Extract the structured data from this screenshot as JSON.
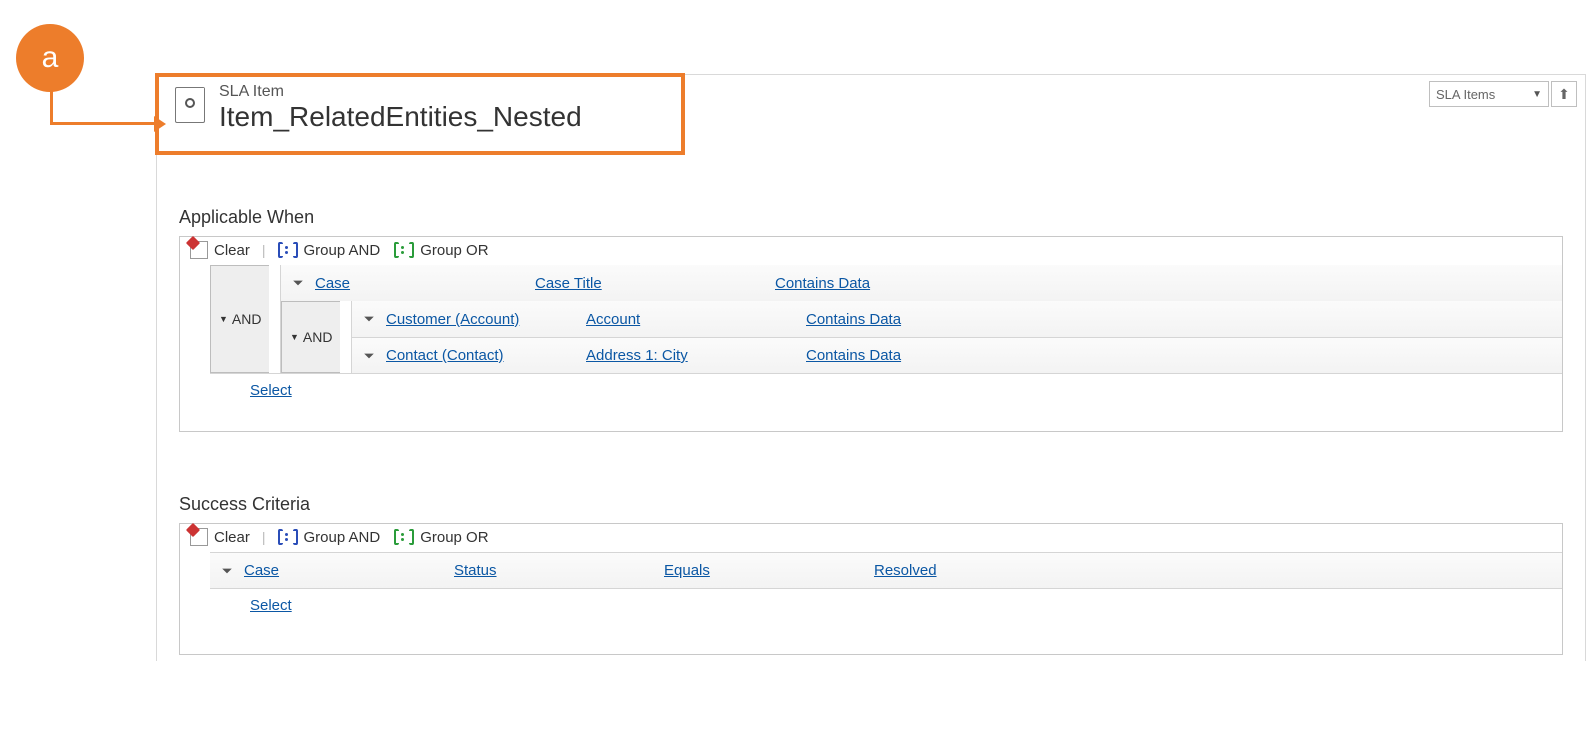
{
  "callout": {
    "badge": "a"
  },
  "header": {
    "entity_type": "SLA Item",
    "entity_name": "Item_RelatedEntities_Nested",
    "nav_section": "SLA Items"
  },
  "toolbar": {
    "clear": "Clear",
    "group_and": "Group AND",
    "group_or": "Group OR"
  },
  "applicable_when": {
    "title": "Applicable When",
    "and_label": "AND",
    "row1": {
      "entity": "Case",
      "field": "Case Title",
      "operator": "Contains Data"
    },
    "nested_and_label": "AND",
    "nested": [
      {
        "entity": "Customer (Account)",
        "field": "Account",
        "operator": "Contains Data"
      },
      {
        "entity": "Contact (Contact)",
        "field": "Address 1: City",
        "operator": "Contains Data"
      }
    ],
    "select": "Select"
  },
  "success_criteria": {
    "title": "Success Criteria",
    "row": {
      "entity": "Case",
      "field": "Status",
      "operator": "Equals",
      "value": "Resolved"
    },
    "select": "Select"
  }
}
